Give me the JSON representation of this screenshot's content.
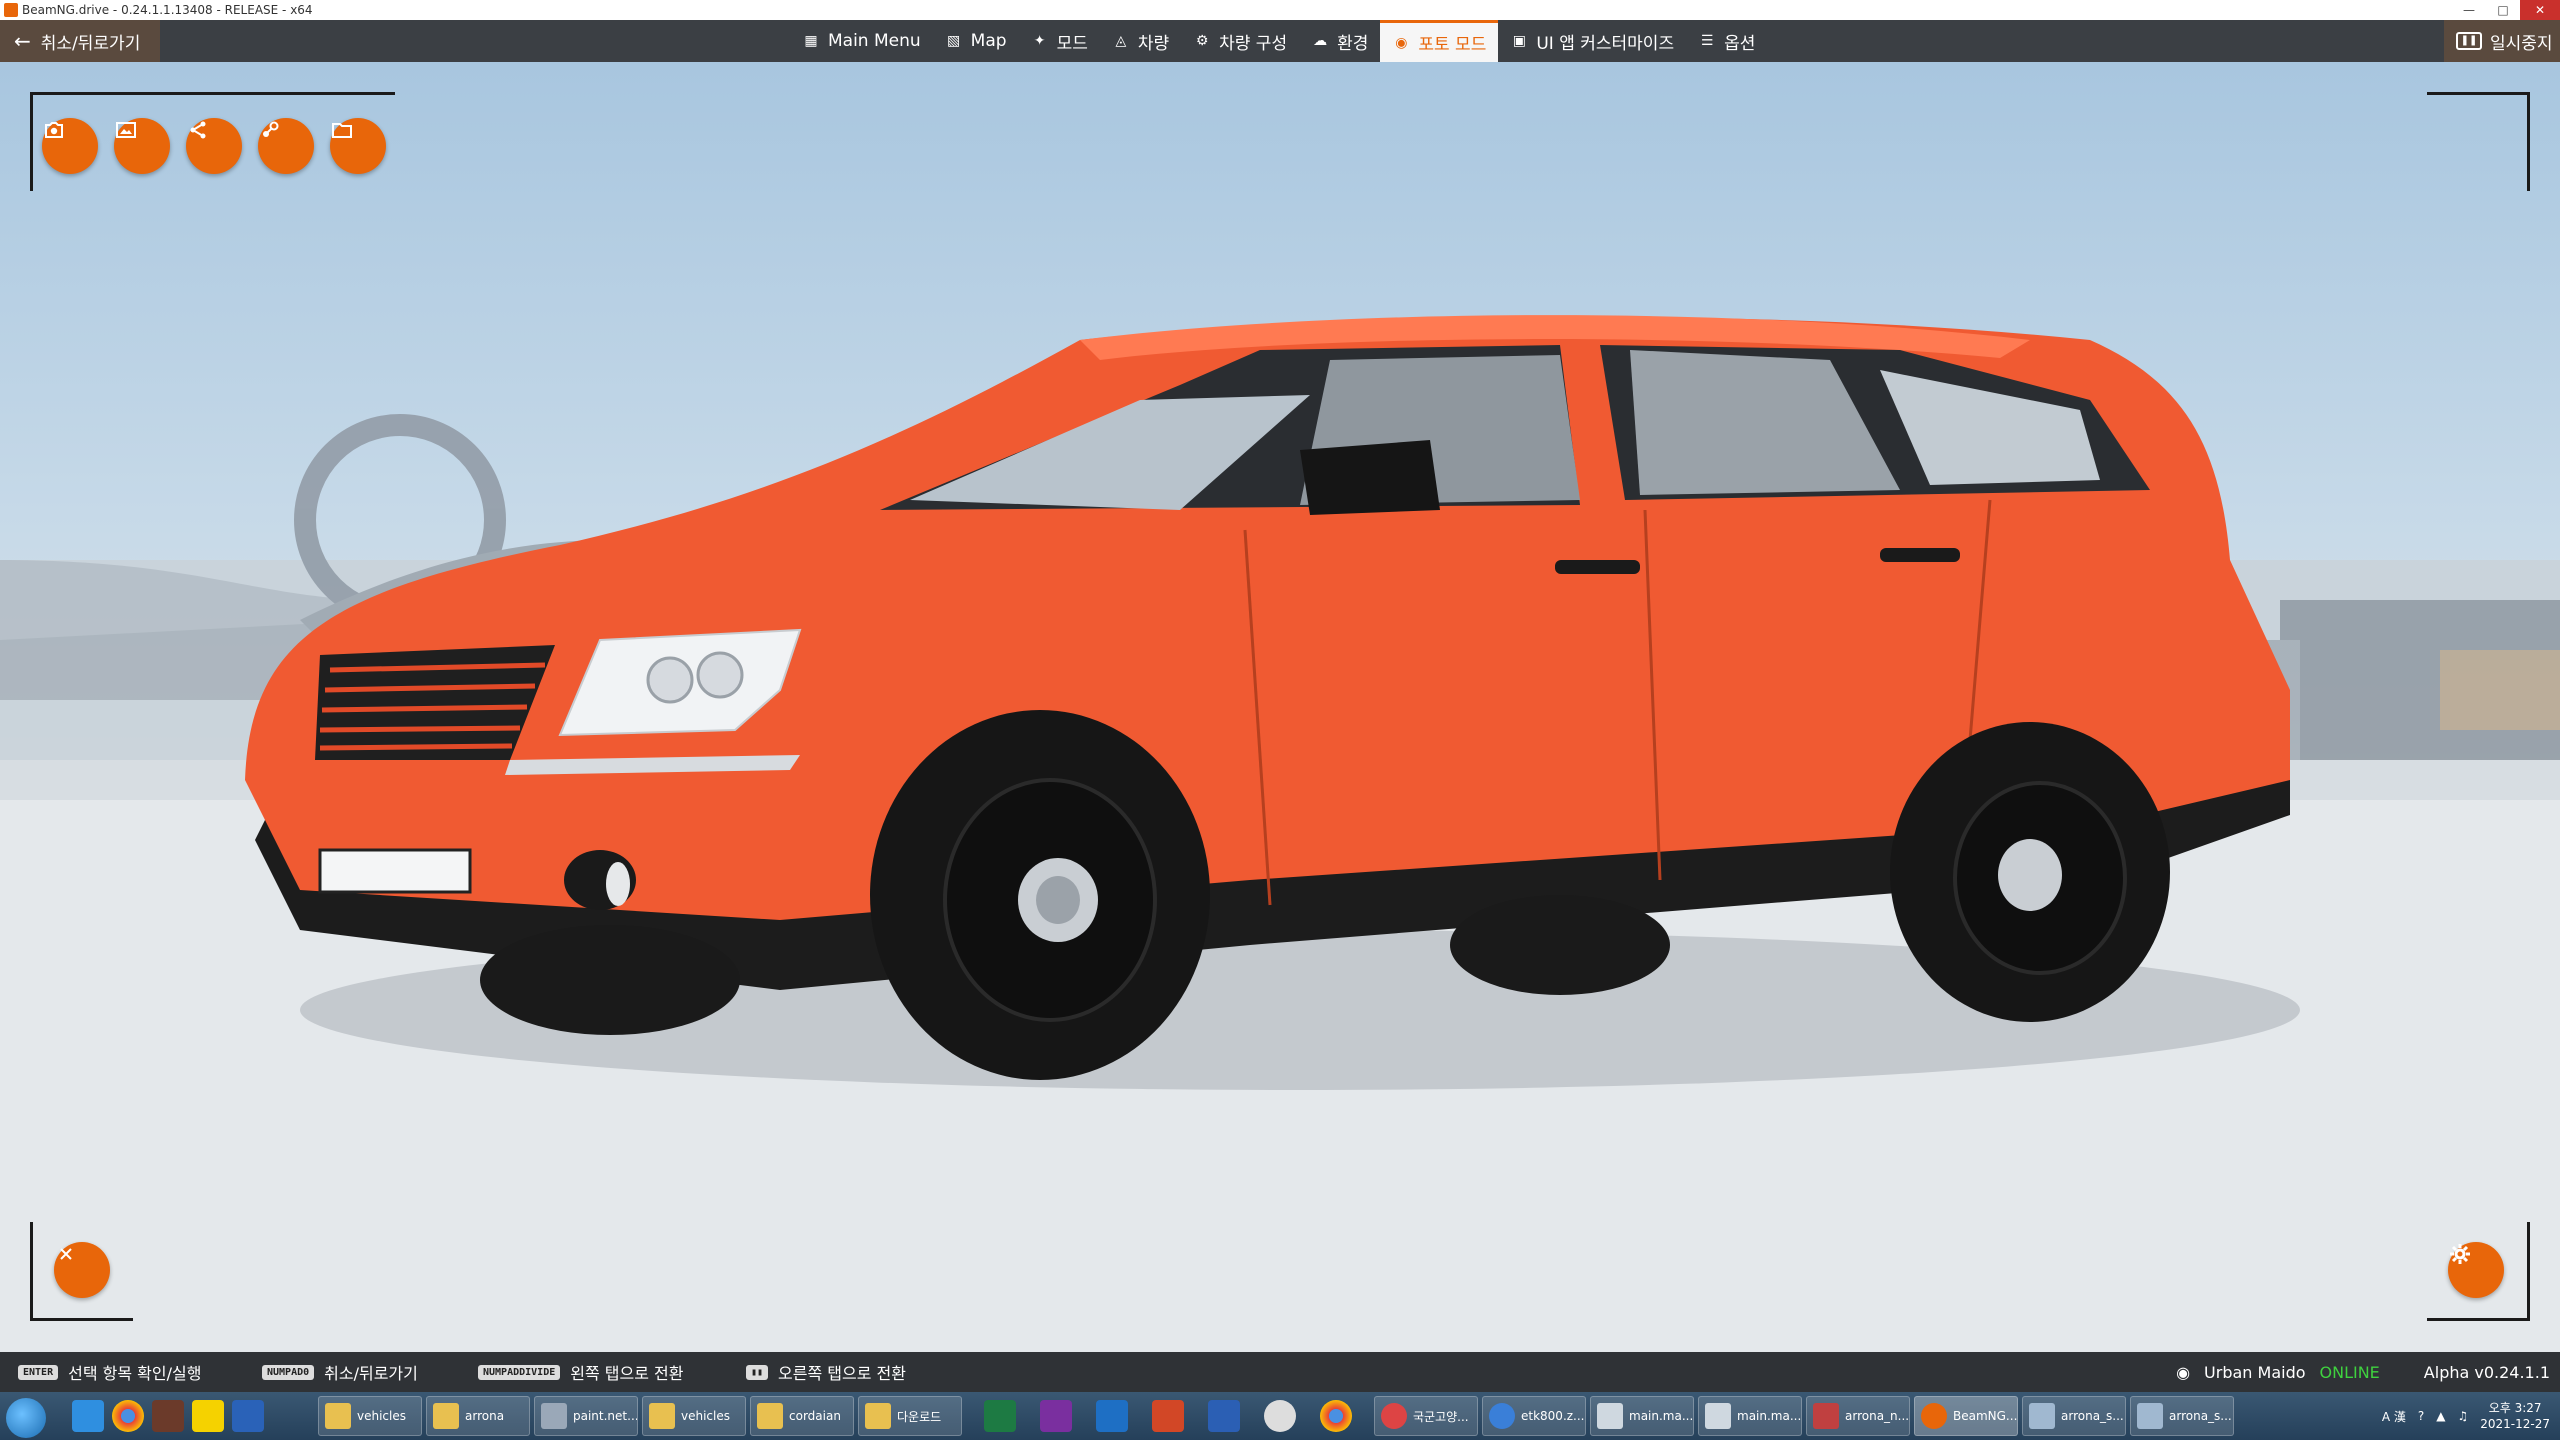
{
  "window": {
    "title": "BeamNG.drive - 0.24.1.1.13408 - RELEASE - x64"
  },
  "menubar": {
    "back_label": "취소/뒤로가기",
    "items": [
      {
        "label": "Main Menu",
        "icon": "grid-icon"
      },
      {
        "label": "Map",
        "icon": "map-icon"
      },
      {
        "label": "모드",
        "icon": "puzzle-icon"
      },
      {
        "label": "차량",
        "icon": "car-icon"
      },
      {
        "label": "차량 구성",
        "icon": "engine-icon"
      },
      {
        "label": "환경",
        "icon": "weather-icon"
      },
      {
        "label": "포토 모드",
        "icon": "camera-icon",
        "active": true
      },
      {
        "label": "UI 앱 커스터마이즈",
        "icon": "ui-apps-icon"
      },
      {
        "label": "옵션",
        "icon": "sliders-icon"
      }
    ],
    "pause_label": "일시중지"
  },
  "photo_mode": {
    "toolbar": [
      {
        "name": "screenshot-button",
        "icon": "camera-icon"
      },
      {
        "name": "hi-res-screenshot-button",
        "icon": "image-icon"
      },
      {
        "name": "share-button",
        "icon": "share-icon"
      },
      {
        "name": "steam-button",
        "icon": "steam-icon"
      },
      {
        "name": "open-folder-button",
        "icon": "folder-icon"
      }
    ],
    "close_icon": "close-icon",
    "settings_icon": "gear-icon"
  },
  "hintbar": {
    "hints": [
      {
        "key": "ENTER",
        "label": "선택 항목 확인/실행"
      },
      {
        "key": "NUMPAD0",
        "label": "취소/뒤로가기"
      },
      {
        "key": "NUMPADDIVIDE",
        "label": "왼쪽 탭으로 전환"
      },
      {
        "key": "",
        "label": "오른쪽 탭으로 전환"
      }
    ],
    "user": "Urban Maido",
    "online": "ONLINE",
    "version": "Alpha v0.24.1.1"
  },
  "taskbar": {
    "tasks": [
      {
        "label": "vehicles",
        "color": "#e8c050"
      },
      {
        "label": "arrona",
        "color": "#e8c050"
      },
      {
        "label": "paint.net...",
        "color": "#9aa8b8"
      },
      {
        "label": "vehicles",
        "color": "#e8c050"
      },
      {
        "label": "cordaian",
        "color": "#e8c050"
      },
      {
        "label": "다운로드",
        "color": "#e8c050"
      },
      {
        "label": "국군고양...",
        "color": "#d44"
      },
      {
        "label": "etk800.z...",
        "color": "#3a7fd8"
      },
      {
        "label": "main.ma...",
        "color": "#cfd8e0"
      },
      {
        "label": "main.ma...",
        "color": "#cfd8e0"
      },
      {
        "label": "arrona_n...",
        "color": "#c04040"
      },
      {
        "label": "BeamNG...",
        "color": "#e8660a"
      },
      {
        "label": "arrona_s...",
        "color": "#a0b8d0"
      },
      {
        "label": "arrona_s...",
        "color": "#a0b8d0"
      }
    ],
    "time": "오후 3:27",
    "date": "2021-12-27"
  }
}
